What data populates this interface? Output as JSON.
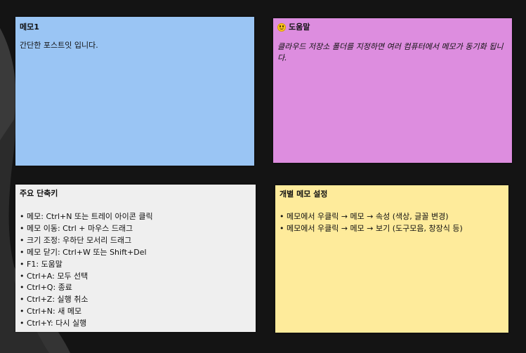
{
  "notes": {
    "memo1": {
      "title": "메모1",
      "body": "간단한 포스트잇 입니다.",
      "color": "#9ac5f4"
    },
    "help": {
      "icon": "smiley-emoji-icon",
      "title": "도움말",
      "body": "클라우드 저장소 폴더를 지정하면 여러 컴퓨터에서 메모가 동기화 됩니다.",
      "color": "#dd8ddf"
    },
    "shortcuts": {
      "title": "주요 단축키",
      "color": "#efefef",
      "items": [
        "메모: Ctrl+N 또는 트레이 아이콘 클릭",
        "메모 이동: Ctrl + 마우스 드래그",
        "크기 조정: 우하단 모서리 드래그",
        "메모 닫기: Ctrl+W 또는 Shift+Del",
        "F1: 도움말",
        "Ctrl+A: 모두 선택",
        "Ctrl+Q: 종료",
        "Ctrl+Z: 실행 취소",
        "Ctrl+N: 새 메모",
        "Ctrl+Y: 다시 실행"
      ]
    },
    "settings": {
      "title": "개별 메모 설정",
      "color": "#feeb9b",
      "items": [
        "메모에서 우클릭 → 메모 → 속성 (색상, 글꼴 변경)",
        "메모에서 우클릭 → 메모 → 보기 (도구모음, 창장식 등)"
      ]
    }
  }
}
